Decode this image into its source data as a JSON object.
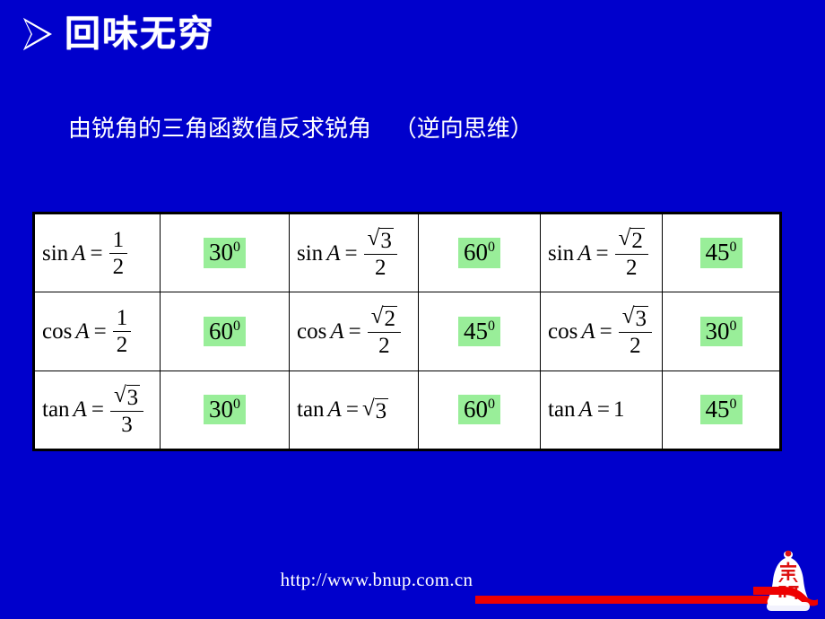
{
  "slide": {
    "background_color": "#0000CC",
    "title": "回味无穷",
    "title_bullet_icon": "arrow-bullet-icon",
    "subtitle": "由锐角的三角函数值反求锐角   （逆向思维）"
  },
  "table": {
    "highlight_color": "#99EE99",
    "rows": [
      {
        "pairs": [
          {
            "function": "sin",
            "variable": "A",
            "value_type": "fraction",
            "numerator": "1",
            "denominator": "2",
            "numerator_radical": false,
            "answer": "30",
            "answer_unit": "0"
          },
          {
            "function": "sin",
            "variable": "A",
            "value_type": "fraction",
            "numerator": "3",
            "denominator": "2",
            "numerator_radical": true,
            "answer": "60",
            "answer_unit": "0"
          },
          {
            "function": "sin",
            "variable": "A",
            "value_type": "fraction",
            "numerator": "2",
            "denominator": "2",
            "numerator_radical": true,
            "answer": "45",
            "answer_unit": "0"
          }
        ]
      },
      {
        "pairs": [
          {
            "function": "cos",
            "variable": "A",
            "value_type": "fraction",
            "numerator": "1",
            "denominator": "2",
            "numerator_radical": false,
            "answer": "60",
            "answer_unit": "0"
          },
          {
            "function": "cos",
            "variable": "A",
            "value_type": "fraction",
            "numerator": "2",
            "denominator": "2",
            "numerator_radical": true,
            "answer": "45",
            "answer_unit": "0"
          },
          {
            "function": "cos",
            "variable": "A",
            "value_type": "fraction",
            "numerator": "3",
            "denominator": "2",
            "numerator_radical": true,
            "answer": "30",
            "answer_unit": "0"
          }
        ]
      },
      {
        "pairs": [
          {
            "function": "tan",
            "variable": "A",
            "value_type": "fraction",
            "numerator": "3",
            "denominator": "3",
            "numerator_radical": true,
            "answer": "30",
            "answer_unit": "0"
          },
          {
            "function": "tan",
            "variable": "A",
            "value_type": "radical",
            "radicand": "3",
            "answer": "60",
            "answer_unit": "0"
          },
          {
            "function": "tan",
            "variable": "A",
            "value_type": "plain",
            "plain_value": "1",
            "answer": "45",
            "answer_unit": "0"
          }
        ]
      }
    ]
  },
  "footer": {
    "url": "http://www.bnup.com.cn",
    "red_bar_color": "#EE0000",
    "logo_name": "bnup-bell-logo",
    "logo_text": "京师",
    "logo_colors": {
      "bell": "#FFFFFF",
      "mark": "#DD1111"
    }
  }
}
